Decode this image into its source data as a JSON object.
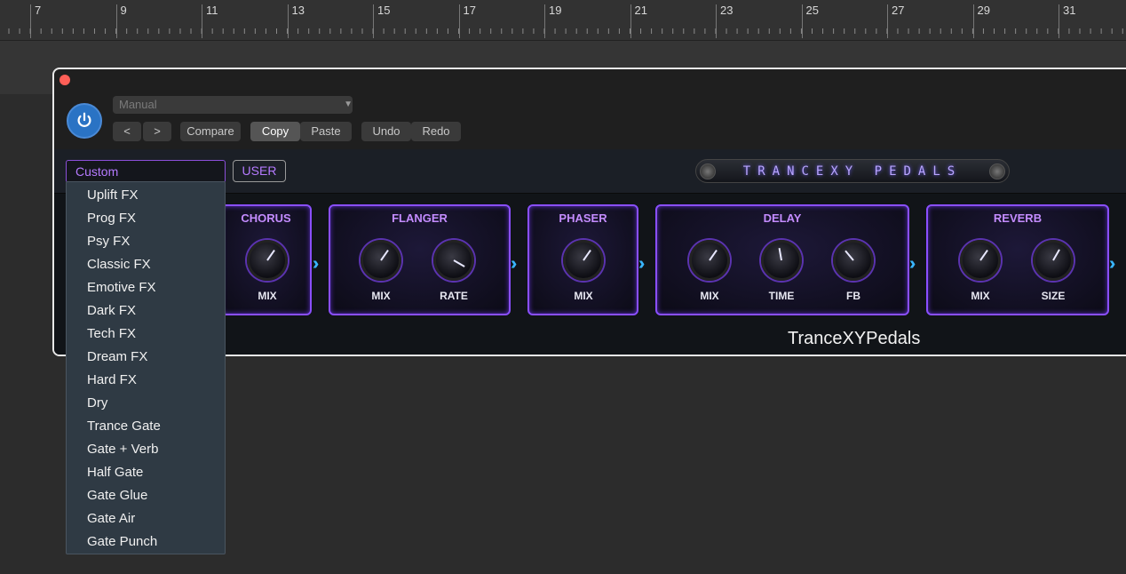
{
  "ruler": {
    "bars": [
      "7",
      "9",
      "11",
      "13",
      "15",
      "17",
      "19",
      "21",
      "23",
      "25",
      "27",
      "29",
      "31"
    ]
  },
  "host": {
    "preset": "Manual",
    "buttons": {
      "prev": "<",
      "next": ">",
      "compare": "Compare",
      "copy": "Copy",
      "paste": "Paste",
      "undo": "Undo",
      "redo": "Redo"
    }
  },
  "plugin": {
    "custom_preset": "Custom",
    "user_button": "USER",
    "logo_text": "TRANCEXY PEDALS",
    "brand": "TranceXYPedals",
    "pedals": [
      {
        "title": "CHORUS",
        "knobs": [
          {
            "label": "MIX"
          }
        ]
      },
      {
        "title": "FLANGER",
        "knobs": [
          {
            "label": "MIX"
          },
          {
            "label": "RATE"
          }
        ]
      },
      {
        "title": "PHASER",
        "knobs": [
          {
            "label": "MIX"
          }
        ]
      },
      {
        "title": "DELAY",
        "knobs": [
          {
            "label": "MIX"
          },
          {
            "label": "TIME"
          },
          {
            "label": "FB"
          }
        ]
      },
      {
        "title": "REVERB",
        "knobs": [
          {
            "label": "MIX"
          },
          {
            "label": "SIZE"
          }
        ]
      }
    ]
  },
  "dropdown": {
    "options": [
      "Uplift FX",
      "Prog FX",
      "Psy FX",
      "Classic FX",
      "Emotive FX",
      "Dark FX",
      "Tech FX",
      "Dream FX",
      "Hard FX",
      "Dry",
      "Trance Gate",
      "Gate + Verb",
      "Half Gate",
      "Gate Glue",
      "Gate Air",
      "Gate Punch"
    ]
  },
  "colors": {
    "accent": "#8a4fff",
    "chevron": "#39b6ff",
    "power": "#2a73c4"
  }
}
